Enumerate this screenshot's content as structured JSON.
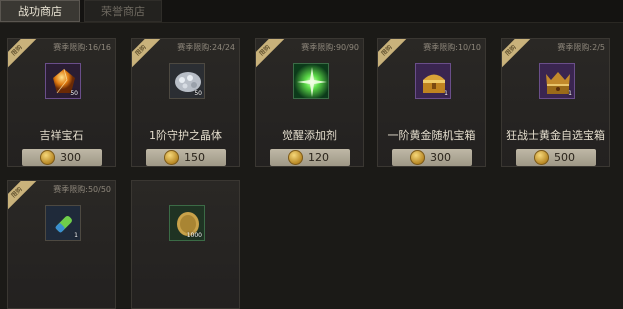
{
  "tabs": [
    {
      "label": "战功商店"
    },
    {
      "label": "荣誉商店"
    }
  ],
  "ribbon_label": "限购",
  "items": [
    {
      "limit": "赛季限购:16/16",
      "name": "吉祥宝石",
      "qty": "50",
      "price": "300",
      "icon": "orange-gem-icon"
    },
    {
      "limit": "赛季限购:24/24",
      "name": "1阶守护之晶体",
      "qty": "50",
      "price": "150",
      "icon": "silver-crystal-icon"
    },
    {
      "limit": "赛季限购:90/90",
      "name": "觉醒添加剂",
      "qty": "",
      "price": "120",
      "icon": "green-spark-icon"
    },
    {
      "limit": "赛季限购:10/10",
      "name": "一阶黄金随机宝箱",
      "qty": "1",
      "price": "300",
      "icon": "gold-chest-icon"
    },
    {
      "limit": "赛季限购:2/5",
      "name": "狂战士黄金自选宝箱",
      "qty": "1",
      "price": "500",
      "icon": "berserker-chest-icon"
    },
    {
      "limit": "赛季限购:50/50",
      "name": "",
      "qty": "1",
      "price": "",
      "icon": "green-vial-icon"
    },
    {
      "limit": "",
      "name": "",
      "qty": "1000",
      "price": "",
      "icon": "gold-coin-icon"
    }
  ]
}
